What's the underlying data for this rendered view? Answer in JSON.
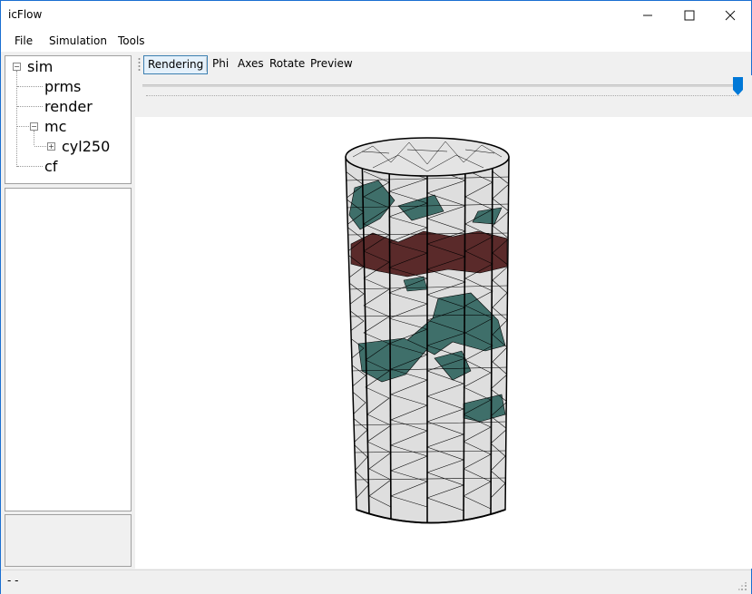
{
  "window": {
    "title": "icFlow"
  },
  "menu": [
    "File",
    "Simulation",
    "Tools"
  ],
  "tree": {
    "root": "sim",
    "children": [
      "prms",
      "render",
      "mc",
      "cf"
    ],
    "mc_child": "cyl250"
  },
  "toolbar": {
    "items": [
      "Rendering",
      "Phi",
      "Axes",
      "Rotate",
      "Preview"
    ],
    "active": "Rendering"
  },
  "slider": {
    "value_fraction": 1.0
  },
  "status": {
    "text": "-  -"
  },
  "colors": {
    "accent": "#0078d7",
    "mesh": "#000000",
    "surface": "#d9d9d9",
    "crack_teal": "#3f6f6a",
    "crack_red": "#5a2a2a"
  }
}
